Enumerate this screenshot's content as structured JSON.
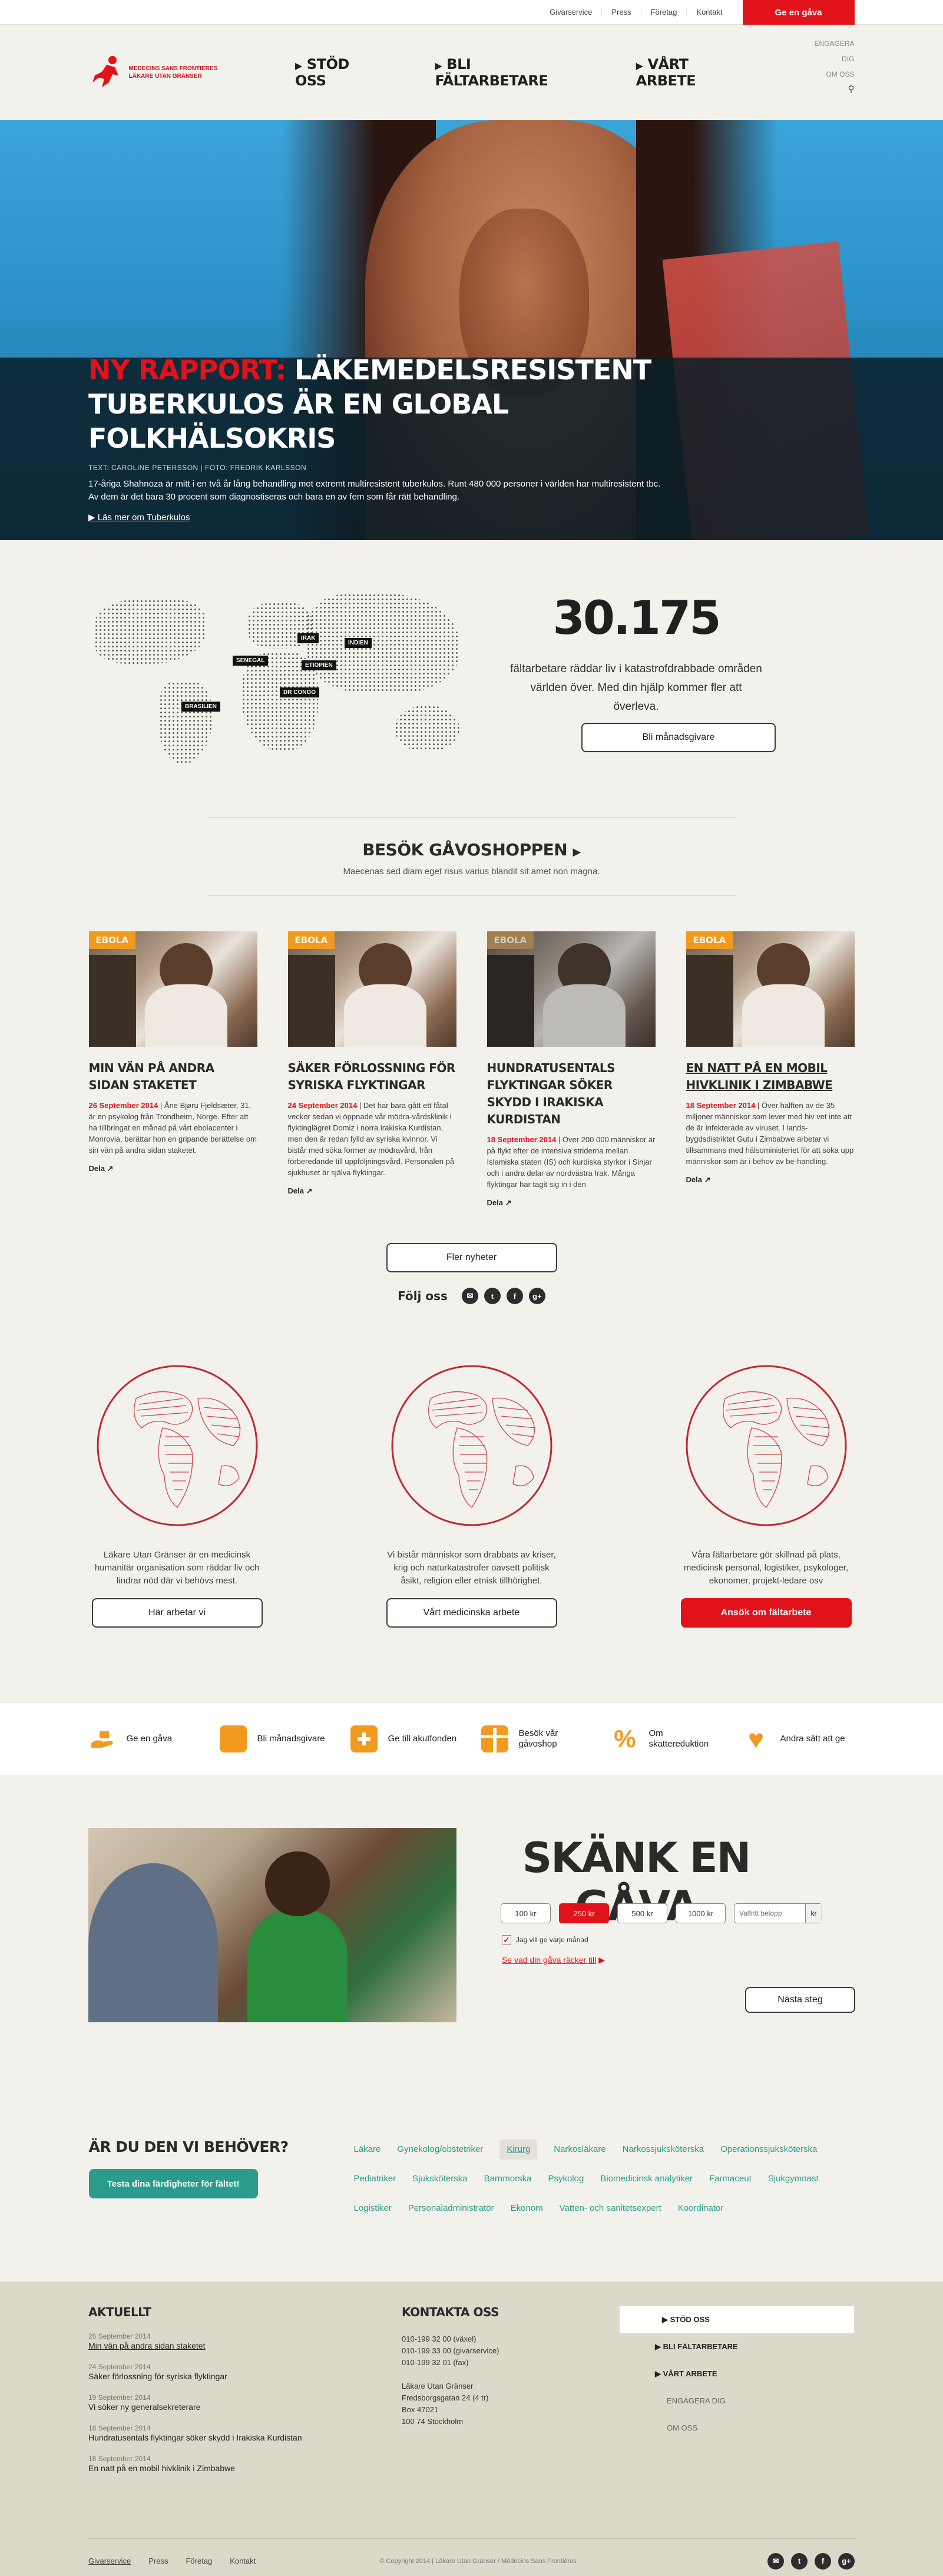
{
  "utility": {
    "links": [
      "Givarservice",
      "Press",
      "Företag",
      "Kontakt"
    ],
    "give_button": "Ge en gåva"
  },
  "logo": {
    "line1": "MEDECINS SANS FRONTIERES",
    "line2": "LÄKARE UTAN GRÄNSER"
  },
  "mainnav": [
    "STÖD OSS",
    "BLI FÄLTARBETARE",
    "VÅRT ARBETE"
  ],
  "sidenav": [
    "ENGAGERA DIG",
    "OM OSS"
  ],
  "hero": {
    "kicker": "NY RAPPORT:",
    "title_rest": " LÄKEMEDELSRESISTENT TUBERKULOS ÄR EN GLOBAL FOLKHÄLSOKRIS",
    "credit": "TEXT: CAROLINE PETERSSON  |  FOTO: FREDRIK KARLSSON",
    "lead": "17-åriga Shahnoza är mitt i en två år lång behandling mot extremt multiresistent tuberkulos. Runt 480 000 personer i världen har multiresistent tbc. Av dem är det bara 30 procent som diagnostiseras och bara en av fem som får rätt behandling.",
    "more": "Läs mer om Tuberkulos"
  },
  "stats": {
    "map_labels": [
      "IRAK",
      "INDIEN",
      "SENEGAL",
      "ETIOPIEN",
      "DR CONGO",
      "BRASILIEN"
    ],
    "number": "30.175",
    "text": "fältarbetare räddar liv i katastrofdrabbade områden världen över. Med din hjälp kommer fler att överleva.",
    "button": "Bli månadsgivare"
  },
  "shop": {
    "title": "BESÖK GÅVOSHOPPEN",
    "text": "Maecenas sed diam eget risus varius blandit sit amet non magna."
  },
  "news": [
    {
      "badge": "EBOLA",
      "title": "MIN VÄN PÅ ANDRA SIDAN STAKETET",
      "date": "26 September 2014",
      "text": " | Åne Bjøru Fjeldsæter, 31, är en psykolog från Trondheim, Norge. Efter att ha tillbringat en månad på vårt ebolacenter i Monrovia, berättar hon en gripande berättelse om sin vän på andra sidan staketet.",
      "share": "Dela"
    },
    {
      "badge": "EBOLA",
      "title": "SÄKER FÖRLOSSNING FÖR SYRISKA FLYKTINGAR",
      "date": "24 September 2014",
      "text": " | Det har bara gått ett fåtal veckor sedan vi öppnade vår mödra-vårdsklinik i flyktinglägret Domiz i norra irakiska Kurdistan, men den är redan fylld av syriska kvinnor. Vi bistår med söka former av mödravård, från förberedande till uppföljningsvård. Personalen på sjukhuset är själva flyktingar.",
      "share": "Dela"
    },
    {
      "badge": "EBOLA",
      "title": "HUNDRATUSENTALS FLYKTINGAR SÖKER SKYDD I IRAKISKA KURDISTAN",
      "date": "18 September 2014",
      "text": " | Över 200 000 människor är på flykt efter de intensiva striderna mellan Islamiska staten (IS) och kurdiska styrkor i Sinjar och i andra delar av nordvästra Irak. Många flyktingar har tagit sig in i den",
      "share": "Dela"
    },
    {
      "badge": "EBOLA",
      "title": "EN NATT PÅ EN MOBIL HIVKLINIK I ZIMBABWE",
      "date": "18 September 2014",
      "text": " | Över hälften av de 35 miljoner människor som lever med hiv vet inte att de är infekterade av viruset. I lands-bygdsdistriktet Gutu i Zimbabwe arbetar vi tillsammans med hälsoministeriet för att söka upp människor som är i behov av be-handling.",
      "share": "Dela"
    }
  ],
  "more_news": "Fler nyheter",
  "follow": {
    "label": "Följ oss",
    "icons": [
      "mail-icon",
      "twitter-icon",
      "facebook-icon",
      "googleplus-icon"
    ]
  },
  "globes": [
    {
      "text": "Läkare Utan Gränser är en medicinsk humanitär organisation som räddar liv och lindrar nöd där vi behövs mest.",
      "button": "Här arbetar vi"
    },
    {
      "text": "Vi bistår människor som drabbats av kriser, krig och naturkatastrofer oavsett politisk åsikt, religion eller etnisk tillhörighet.",
      "button": "Vårt medicinska arbete"
    },
    {
      "text": "Våra fältarbetare gör skillnad på plats, medicinsk personal, logistiker, psykologer, ekonomer, projekt-ledare osv",
      "button": "Ansök om fältarbete"
    }
  ],
  "strip": [
    {
      "icon": "hand-gift-icon",
      "label": "Ge en gåva"
    },
    {
      "icon": "wallet-icon",
      "label": "Bli månadsgivare"
    },
    {
      "icon": "firstaid-icon",
      "label": "Ge till akutfonden"
    },
    {
      "icon": "gift-box-icon",
      "label": "Besök vår gåvoshop"
    },
    {
      "icon": "percent-icon",
      "label": "Om skattereduktion"
    },
    {
      "icon": "heart-icon",
      "label": "Andra sätt att ge"
    }
  ],
  "gift": {
    "title": "SKÄNK EN GÅVA",
    "amounts": [
      "100 kr",
      "250 kr",
      "500 kr",
      "1000 kr"
    ],
    "selected_amount": "250 kr",
    "custom_placeholder": "Valfritt belopp",
    "unit": "kr",
    "monthly_label": "Jag vill ge varje månad",
    "monthly_checked": true,
    "see_link": "Se vad din gåva räcker till",
    "next": "Nästa steg"
  },
  "need": {
    "title": "ÄR DU DEN VI BEHÖVER?",
    "test_button": "Testa dina färdigheter för fältet!",
    "professions": [
      "Läkare",
      "Gynekolog/obstetriker",
      "Kirurg",
      "Narkosläkare",
      "Narkossjuksköterska",
      "Operationssjuksköterska",
      "Pediatriker",
      "Sjuksköterska",
      "Barnmorska",
      "Psykolog",
      "Biomedicinsk analytiker",
      "Farmaceut",
      "Sjukgymnast",
      "Logistiker",
      "Personaladministratör",
      "Ekonom",
      "Vatten- och sanitetsexpert",
      "Koordinator"
    ],
    "highlighted": "Kirurg"
  },
  "footer": {
    "news_title": "AKTUELLT",
    "news": [
      {
        "date": "26 September 2014",
        "title": "Min vän på andra sidan staketet"
      },
      {
        "date": "24 September 2014",
        "title": "Säker förlossning för syriska flyktingar"
      },
      {
        "date": "19 September 2014",
        "title": "Vi söker ny generalsekreterare"
      },
      {
        "date": "18 September 2014",
        "title": "Hundratusentals flyktingar söker skydd i Irakiska Kurdistan"
      },
      {
        "date": "18 September 2014",
        "title": "En natt på en mobil hivklinik i Zimbabwe"
      }
    ],
    "contact_title": "KONTAKTA OSS",
    "phones": [
      "010-199 32 00 (växel)",
      "010-199 33 00 (givarservice)",
      "010-199 32 01 (fax)"
    ],
    "address": [
      "Läkare Utan Gränser",
      "Fredsborgsgatan 24 (4 tr)",
      "Box 47021",
      "100 74 Stockholm"
    ],
    "nav": [
      "STÖD OSS",
      "BLI FÄLTARBETARE",
      "VÅRT ARBETE",
      "ENGAGERA DIG",
      "OM OSS"
    ],
    "bottom_links": [
      "Givarservice",
      "Press",
      "Företag",
      "Kontakt"
    ],
    "copyright": "© Copyright 2014 | Läkare Utan Gränser / Médecins Sans Frontières"
  },
  "colors": {
    "brand_red": "#e2121b",
    "accent_orange": "#f29a1e",
    "teal": "#2a9c8c"
  }
}
